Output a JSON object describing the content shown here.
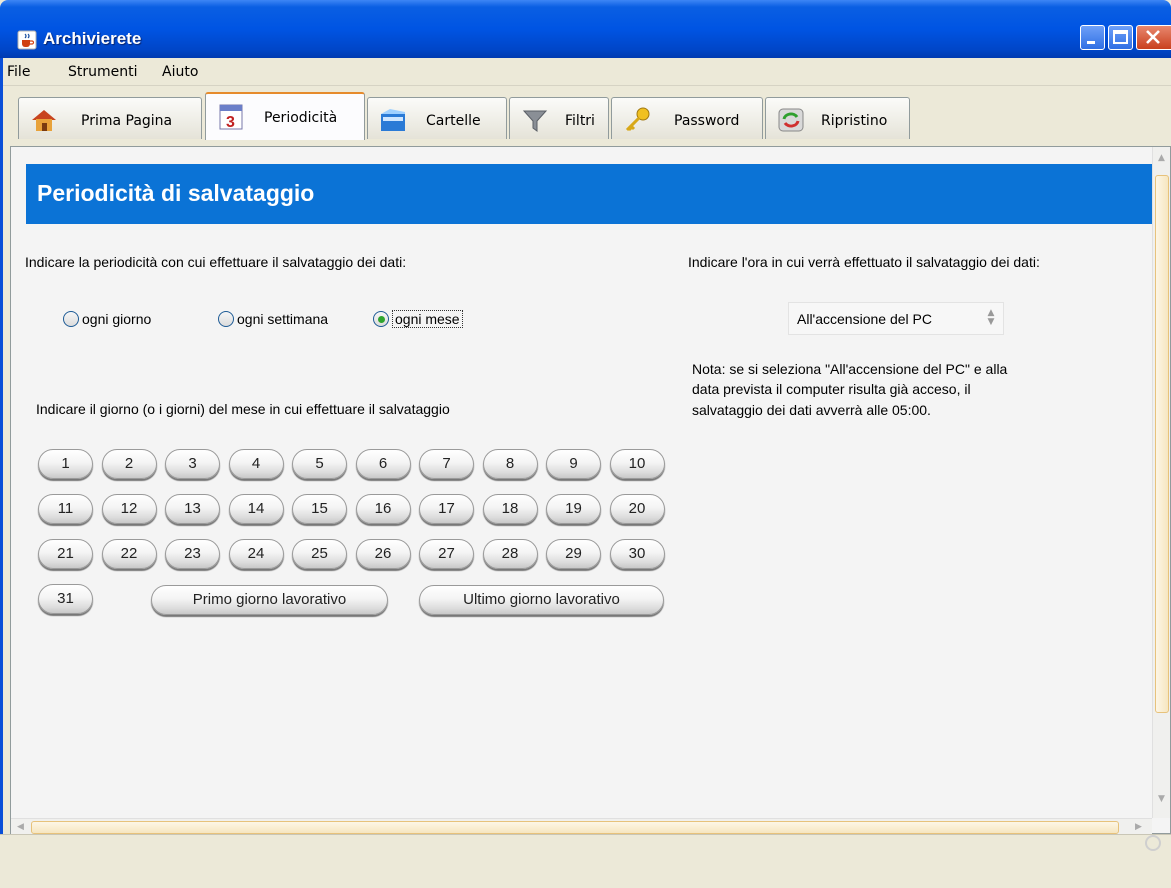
{
  "window": {
    "title": "Archivierete"
  },
  "menu": [
    "File",
    "Strumenti",
    "Aiuto"
  ],
  "tabs": [
    {
      "label": "Prima Pagina",
      "icon": "house-icon",
      "active": false
    },
    {
      "label": "Periodicità",
      "icon": "calendar-icon",
      "active": true
    },
    {
      "label": "Cartelle",
      "icon": "folder-icon",
      "active": false
    },
    {
      "label": "Filtri",
      "icon": "funnel-icon",
      "active": false
    },
    {
      "label": "Password",
      "icon": "key-icon",
      "active": false
    },
    {
      "label": "Ripristino",
      "icon": "restore-icon",
      "active": false
    }
  ],
  "panel": {
    "header": "Periodicità di salvataggio",
    "periodicity_prompt": "Indicare la periodicità con cui effettuare il salvataggio dei dati:",
    "radios": [
      {
        "label": "ogni giorno",
        "checked": false
      },
      {
        "label": "ogni settimana",
        "checked": false
      },
      {
        "label": "ogni mese",
        "checked": true
      }
    ],
    "day_prompt": "Indicare il giorno (o i giorni) del mese in cui effettuare il salvataggio",
    "days": [
      "1",
      "2",
      "3",
      "4",
      "5",
      "6",
      "7",
      "8",
      "9",
      "10",
      "11",
      "12",
      "13",
      "14",
      "15",
      "16",
      "17",
      "18",
      "19",
      "20",
      "21",
      "22",
      "23",
      "24",
      "25",
      "26",
      "27",
      "28",
      "29",
      "30",
      "31"
    ],
    "first_workday": "Primo giorno lavorativo",
    "last_workday": "Ultimo giorno lavorativo",
    "time_prompt": "Indicare l'ora in cui verrà effettuato il salvataggio dei dati:",
    "time_value": "All'accensione del PC",
    "note_lines": [
      "Nota: se si seleziona \"All'accensione del PC\" e alla",
      "data prevista il computer risulta già acceso, il",
      "salvataggio dei dati avverrà alle 05:00."
    ]
  },
  "colors": {
    "header_band": "#0b73d6",
    "titlebar": "#0054e3",
    "active_tab_accent": "#e68b2c"
  }
}
